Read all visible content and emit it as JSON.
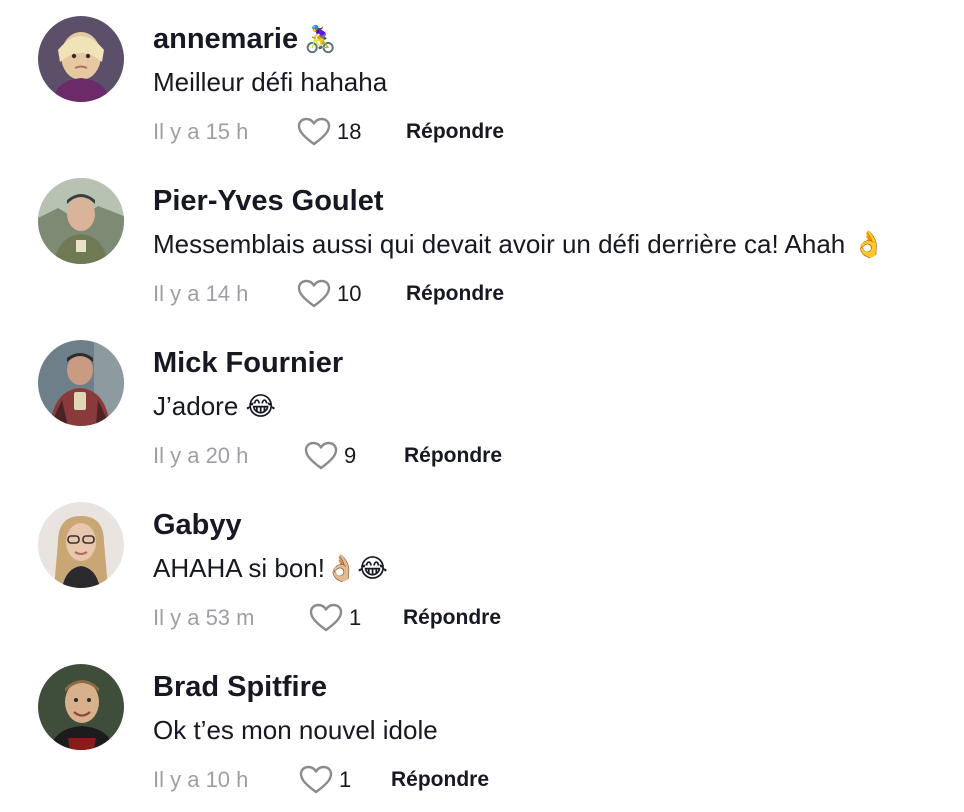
{
  "reply_label": "Répondre",
  "comments": [
    {
      "username": "annemarie",
      "username_emoji": "🚴‍♀️",
      "text": "Meilleur défi hahaha",
      "time": "Il y a 15 h",
      "likes": "18",
      "avatar_colors": [
        "#5b4f6a",
        "#e6c9a0",
        "#6c2a6b"
      ]
    },
    {
      "username": "Pier-Yves Goulet",
      "text": "Messemblais aussi qui devait avoir un défi derrière ca! Ahah 👌",
      "time": "Il y a 14 h",
      "likes": "10",
      "avatar_colors": [
        "#9aa3a0",
        "#d9b49a",
        "#6f7a55"
      ]
    },
    {
      "username": "Mick Fournier",
      "text": "J’adore 😂",
      "time": "Il y a 20 h",
      "likes": "9",
      "avatar_colors": [
        "#6e7f8a",
        "#c99b82",
        "#8a3a3a"
      ]
    },
    {
      "username": "Gabyy",
      "text": "AHAHA si bon!👌🏼😂",
      "time": "Il y a 53 m",
      "likes": "1",
      "avatar_colors": [
        "#e9e4e0",
        "#e8c7ae",
        "#c9a774"
      ]
    },
    {
      "username": "Brad Spitfire",
      "text": "Ok t’es mon nouvel idole",
      "time": "Il y a 10 h",
      "likes": "1",
      "avatar_colors": [
        "#3f4e3a",
        "#d9b08c",
        "#8b1a1a"
      ]
    }
  ]
}
